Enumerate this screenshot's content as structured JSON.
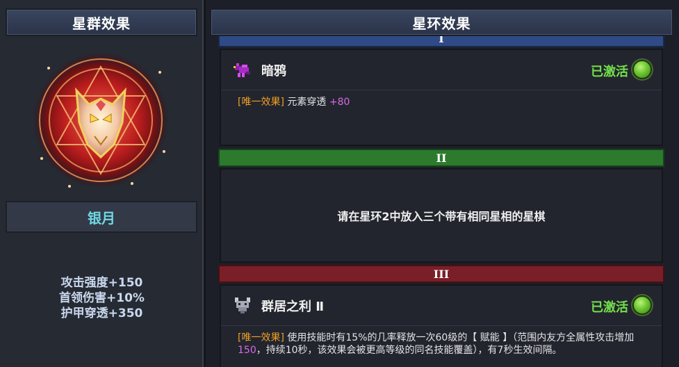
{
  "left": {
    "header": "星群效果",
    "name": "银月",
    "stats": [
      "攻击强度+150",
      "首领伤害+10%",
      "护甲穿透+350"
    ]
  },
  "right": {
    "header": "星环效果",
    "tiers": [
      {
        "numeral": "I",
        "color": "#2f4a86",
        "title": "暗鸦",
        "icon": "raven-icon",
        "status": "已激活",
        "tag": "[唯一效果]",
        "desc_text": "元素穿透",
        "desc_value": "+80"
      },
      {
        "numeral": "II",
        "color": "#2c7a2e",
        "requirement": "请在星环2中放入三个带有相同星相的星棋"
      },
      {
        "numeral": "III",
        "color": "#7a1f27",
        "title": "群居之利 Ⅱ",
        "icon": "wolf-icon",
        "status": "已激活",
        "tag": "[唯一效果]",
        "desc_part1": "使用技能时有15%的几率释放一次60级的【 赋能 】（范围内友方全属性攻击增加",
        "desc_value": "150",
        "desc_part2": "，持续10秒，该效果会被更高等级的同名技能覆盖），有7秒生效间隔。"
      }
    ]
  },
  "colors": {
    "active_green": "#74e04a",
    "tag_orange": "#f0a028",
    "value_purple": "#d86ae8",
    "name_cyan": "#6fd7e2"
  }
}
